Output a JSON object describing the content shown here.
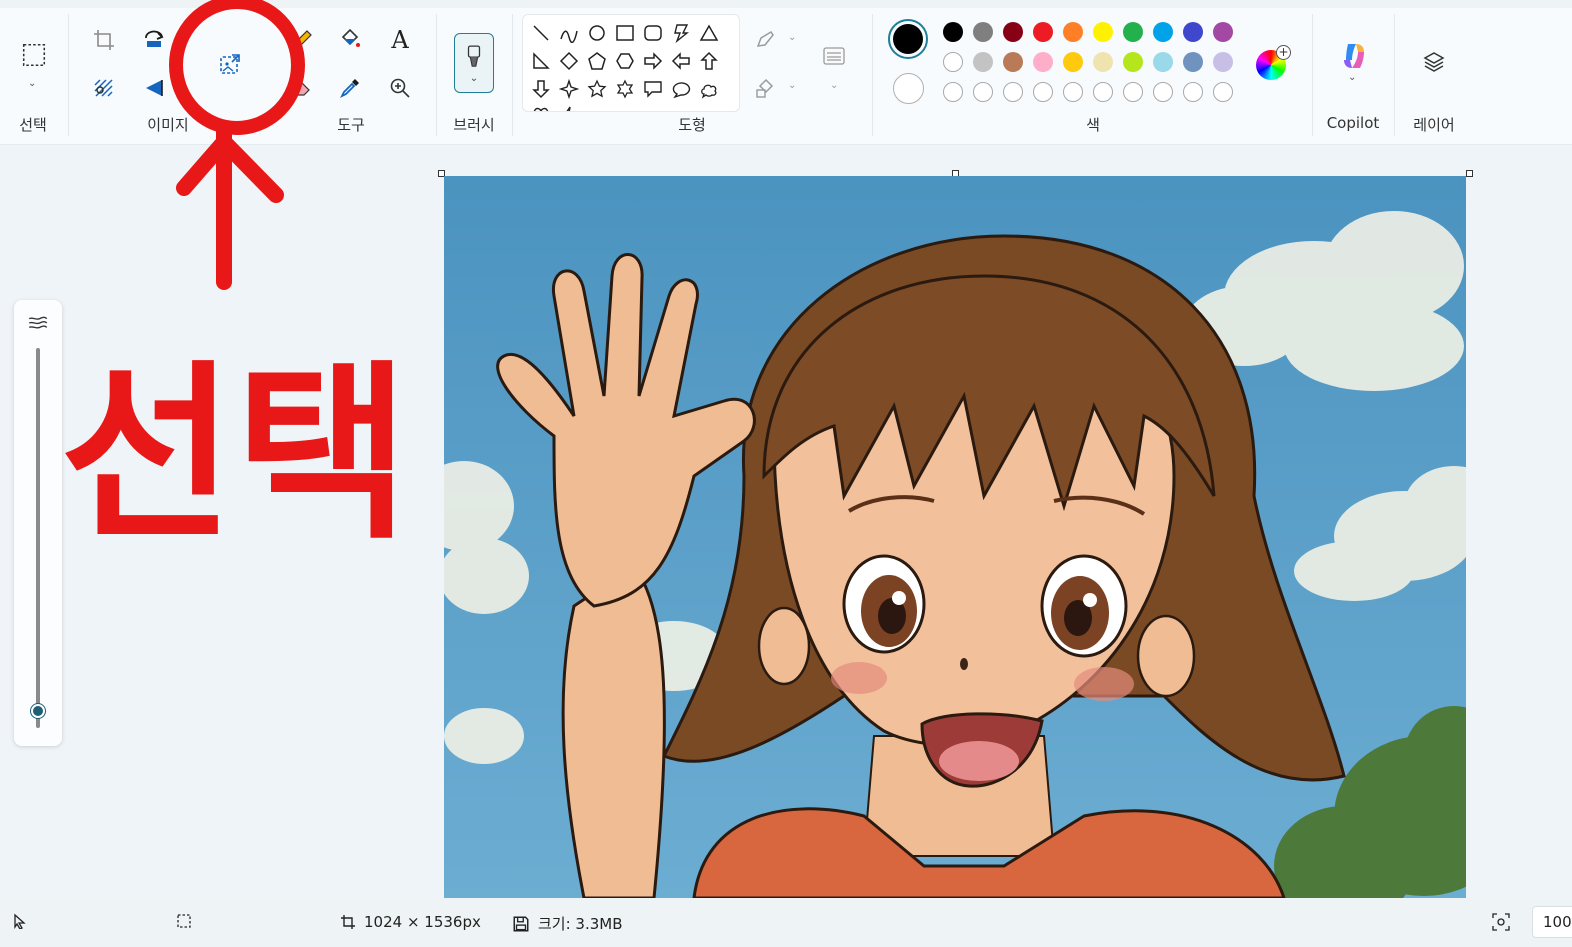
{
  "ribbon": {
    "groups": {
      "selection": "선택",
      "image": "이미지",
      "tools": "도구",
      "brush": "브러시",
      "shapes": "도형",
      "colors": "색",
      "copilot": "Copilot",
      "layers": "레이어"
    },
    "text_tool_glyph": "A"
  },
  "colors": {
    "primary": "#000000",
    "secondary": "#ffffff",
    "palette_row1": [
      "#000000",
      "#7f7f7f",
      "#880015",
      "#ed1c24",
      "#ff7f27",
      "#fff200",
      "#22b14c",
      "#00a2e8",
      "#3f48cc",
      "#a349a4"
    ],
    "palette_row2": [
      "#ffffff",
      "#c3c3c3",
      "#b97a57",
      "#ffaec9",
      "#ffc90e",
      "#efe4b0",
      "#b5e61d",
      "#99d9ea",
      "#7092be",
      "#c8bfe7"
    ],
    "palette_row3_empty": 10
  },
  "annotation": {
    "text": "선택",
    "color": "#e81818"
  },
  "statusbar": {
    "dimensions": "1024 × 1536px",
    "size": "크기: 3.3MB",
    "zoom": "100"
  }
}
